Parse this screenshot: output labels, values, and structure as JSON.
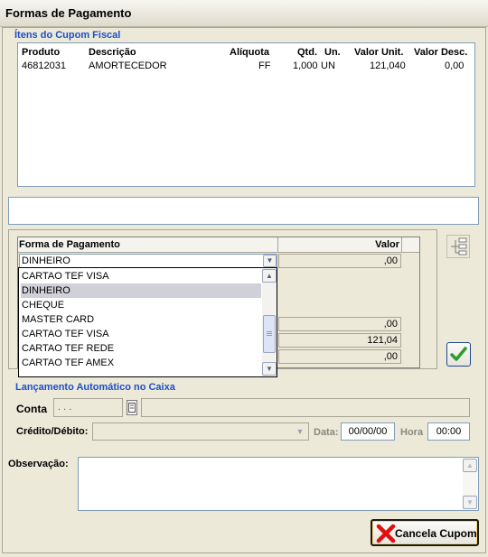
{
  "window": {
    "title": "Formas de Pagamento"
  },
  "itens": {
    "group_title": "Ítens do Cupom Fiscal",
    "columns": {
      "produto": "Produto",
      "descricao": "Descrição",
      "aliquota": "Alíquota",
      "qtd": "Qtd.",
      "un": "Un.",
      "valor_unit": "Valor Unit.",
      "valor_desc": "Valor Desc."
    },
    "rows": [
      {
        "produto": "46812031",
        "descricao": "AMORTECEDOR",
        "aliquota": "FF",
        "qtd": "1,000",
        "un": "UN",
        "valor_unit": "121,040",
        "valor_desc": "0,00"
      }
    ]
  },
  "message_box": {
    "text": ""
  },
  "pagamento": {
    "col_forma": "Forma de Pagamento",
    "col_valor": "Valor",
    "selected_forma": "DINHEIRO",
    "selected_valor": ",00",
    "dropdown_options": [
      "CARTAO TEF VISA",
      "DINHEIRO",
      "CHEQUE",
      "MASTER CARD",
      "CARTAO TEF VISA",
      "CARTAO TEF REDE",
      "CARTAO TEF AMEX"
    ],
    "highlighted_index": 1,
    "summary_values": [
      ",00",
      "121,04",
      ",00"
    ]
  },
  "lancamento": {
    "group_title": "Lançamento Automático no Caixa",
    "conta_label": "Conta",
    "conta_value": ". . .",
    "credito_label": "Crédito/Débito:",
    "data_label": "Data:",
    "data_value": "00/00/00",
    "hora_label": "Hora",
    "hora_value": "00:00"
  },
  "observacao": {
    "label": "Observação:"
  },
  "buttons": {
    "cancela_label": "Cancela Cupom"
  },
  "icons": {
    "confirm": "check-icon",
    "cancel": "red-x-icon",
    "tree": "tree-list-icon",
    "lookup": "lookup-icon"
  },
  "colors": {
    "group_title": "#1e4fc8",
    "check": "#2e9b2e",
    "cancel_x": "#e01010"
  }
}
